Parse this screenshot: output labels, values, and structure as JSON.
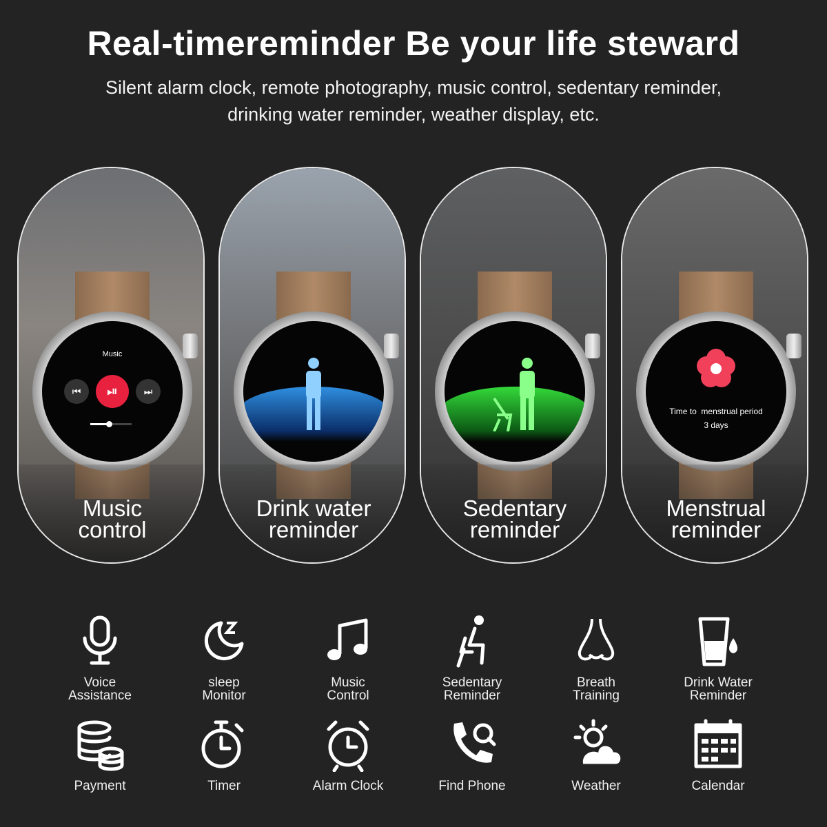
{
  "header": {
    "title": "Real-timereminder Be your life steward",
    "subtitle_line1": "Silent alarm clock, remote photography, music control, sedentary reminder,",
    "subtitle_line2": "drinking water reminder, weather display, etc."
  },
  "panels": [
    {
      "caption1": "Music",
      "caption2": "control",
      "screen": {
        "title": "Music"
      }
    },
    {
      "caption1": "Drink water",
      "caption2": "reminder"
    },
    {
      "caption1": "Sedentary",
      "caption2": "reminder"
    },
    {
      "caption1": "Menstrual",
      "caption2": "reminder",
      "screen": {
        "line1": "Time to  menstrual period",
        "line2": "3 days"
      }
    }
  ],
  "colors": {
    "background": "#232323",
    "accent_red": "#e8213f",
    "water_blue": "#2f8fe0",
    "sedentary_green": "#34d93a"
  },
  "features": [
    {
      "label": "Voice\nAssistance",
      "icon": "microphone-icon"
    },
    {
      "label": "sleep\nMonitor",
      "icon": "moon-sleep-icon"
    },
    {
      "label": "Music\nControl",
      "icon": "music-note-icon"
    },
    {
      "label": "Sedentary\nReminder",
      "icon": "sitting-person-icon"
    },
    {
      "label": "Breath\nTraining",
      "icon": "nose-icon"
    },
    {
      "label": "Drink Water\nReminder",
      "icon": "water-glass-icon"
    },
    {
      "label": "Payment",
      "icon": "coins-icon"
    },
    {
      "label": "Timer",
      "icon": "stopwatch-icon"
    },
    {
      "label": "Alarm Clock",
      "icon": "alarm-clock-icon"
    },
    {
      "label": "Find Phone",
      "icon": "phone-search-icon"
    },
    {
      "label": "Weather",
      "icon": "sun-cloud-icon"
    },
    {
      "label": "Calendar",
      "icon": "calendar-icon"
    }
  ]
}
